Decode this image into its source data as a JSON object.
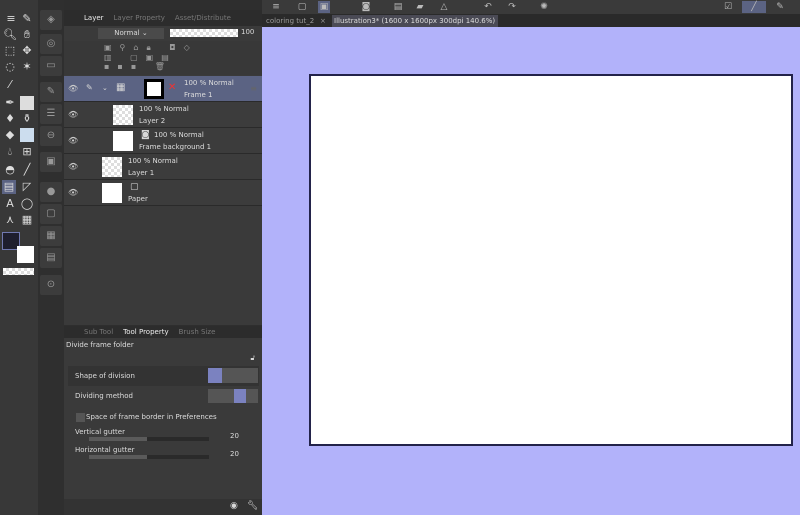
{
  "layer_panel": {
    "tabs": [
      "Layer",
      "Layer Property",
      "Asset/Distribute"
    ],
    "blend_mode": "Normal",
    "opacity": "100",
    "layers": [
      {
        "name": "Frame 1",
        "info": "100 % Normal",
        "selected": true
      },
      {
        "name": "Layer 2",
        "info": "100 % Normal"
      },
      {
        "name": "Frame background 1",
        "info": "100 % Normal"
      },
      {
        "name": "Layer 1",
        "info": "100 % Normal"
      },
      {
        "name": "Paper",
        "info": ""
      }
    ]
  },
  "tool_property": {
    "tabs": [
      "Sub Tool",
      "Tool Property",
      "Brush Size"
    ],
    "tool_name": "Divide frame folder",
    "shape_of_division": "Shape of division",
    "dividing_method": "Dividing method",
    "space_checkbox": "Space of frame border in Preferences",
    "space_checked": false,
    "vertical_gutter": {
      "label": "Vertical gutter",
      "value": "20"
    },
    "horizontal_gutter": {
      "label": "Horizontal gutter",
      "value": "20"
    }
  },
  "document_tabs": [
    {
      "label": "coloring tut_2",
      "active": false
    },
    {
      "label": "Illustration3* (1600 x 1600px 300dpi 140.6%)",
      "active": true
    }
  ],
  "colors": {
    "canvas_bg": "#b2b2fa",
    "main_color": "#1e1e2e",
    "sub_color": "#ffffff",
    "selected_layer": "#5b6383"
  }
}
